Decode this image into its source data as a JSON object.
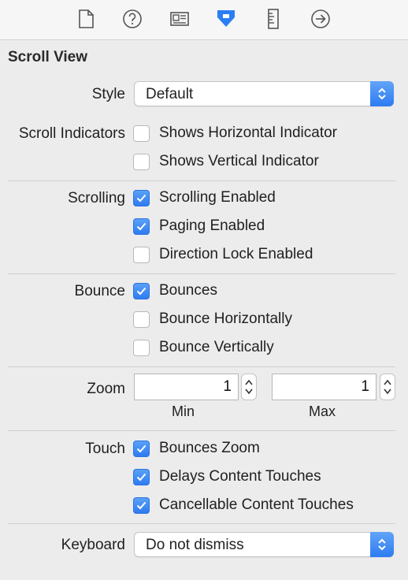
{
  "panel_title": "Scroll View",
  "toolbar": {
    "icons": [
      "file-inspector-icon",
      "quick-help-icon",
      "identity-inspector-icon",
      "attributes-inspector-icon",
      "size-inspector-icon",
      "connections-inspector-icon"
    ],
    "active": "attributes-inspector-icon",
    "accent": "#2b7ef5"
  },
  "style": {
    "label": "Style",
    "value": "Default"
  },
  "scroll_indicators": {
    "label": "Scroll Indicators",
    "options": [
      {
        "label": "Shows Horizontal Indicator",
        "checked": false
      },
      {
        "label": "Shows Vertical Indicator",
        "checked": false
      }
    ]
  },
  "scrolling": {
    "label": "Scrolling",
    "options": [
      {
        "label": "Scrolling Enabled",
        "checked": true
      },
      {
        "label": "Paging Enabled",
        "checked": true
      },
      {
        "label": "Direction Lock Enabled",
        "checked": false
      }
    ]
  },
  "bounce": {
    "label": "Bounce",
    "options": [
      {
        "label": "Bounces",
        "checked": true
      },
      {
        "label": "Bounce Horizontally",
        "checked": false
      },
      {
        "label": "Bounce Vertically",
        "checked": false
      }
    ]
  },
  "zoom": {
    "label": "Zoom",
    "min_value": "1",
    "min_label": "Min",
    "max_value": "1",
    "max_label": "Max"
  },
  "touch": {
    "label": "Touch",
    "options": [
      {
        "label": "Bounces Zoom",
        "checked": true
      },
      {
        "label": "Delays Content Touches",
        "checked": true
      },
      {
        "label": "Cancellable Content Touches",
        "checked": true
      }
    ]
  },
  "keyboard": {
    "label": "Keyboard",
    "value": "Do not dismiss"
  }
}
